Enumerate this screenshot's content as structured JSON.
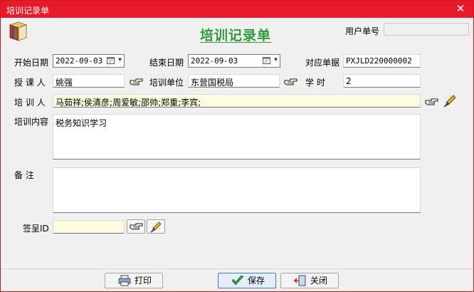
{
  "window": {
    "title": "培训记录单",
    "close_glyph": "✕"
  },
  "header": {
    "form_title": "培训记录单",
    "user_no_label": "用户单号",
    "user_no_value": ""
  },
  "form": {
    "start_date_label": "开始日期",
    "start_date_value": "2022-09-03",
    "end_date_label": "结束日期",
    "end_date_value": "2022-09-03",
    "doc_no_label": "对应单据",
    "doc_no_value": "PXJLD220000002",
    "teacher_label": "授 课 人",
    "teacher_value": "姚强",
    "unit_label": "培训单位",
    "unit_value": "东营国税局",
    "hours_label": "学    时",
    "hours_value": "2",
    "trainees_label": "培 训 人",
    "trainees_value": "马茹祥;侯清彦;周爱敏;邵帅;郑重;李宾;",
    "content_label": "培训内容",
    "content_value": "税务知识学习",
    "remark_label": "备    注",
    "remark_value": "",
    "sign_label": "签呈ID",
    "sign_value": ""
  },
  "footer": {
    "print_label": "打印",
    "save_label": "保存",
    "close_label": "关闭"
  },
  "icons": [
    "app-logo-icon",
    "calendar-icon",
    "dropdown-arrow-icon",
    "pointing-hand-icon",
    "edit-brush-icon",
    "printer-icon",
    "checkmark-icon",
    "exit-door-icon"
  ]
}
